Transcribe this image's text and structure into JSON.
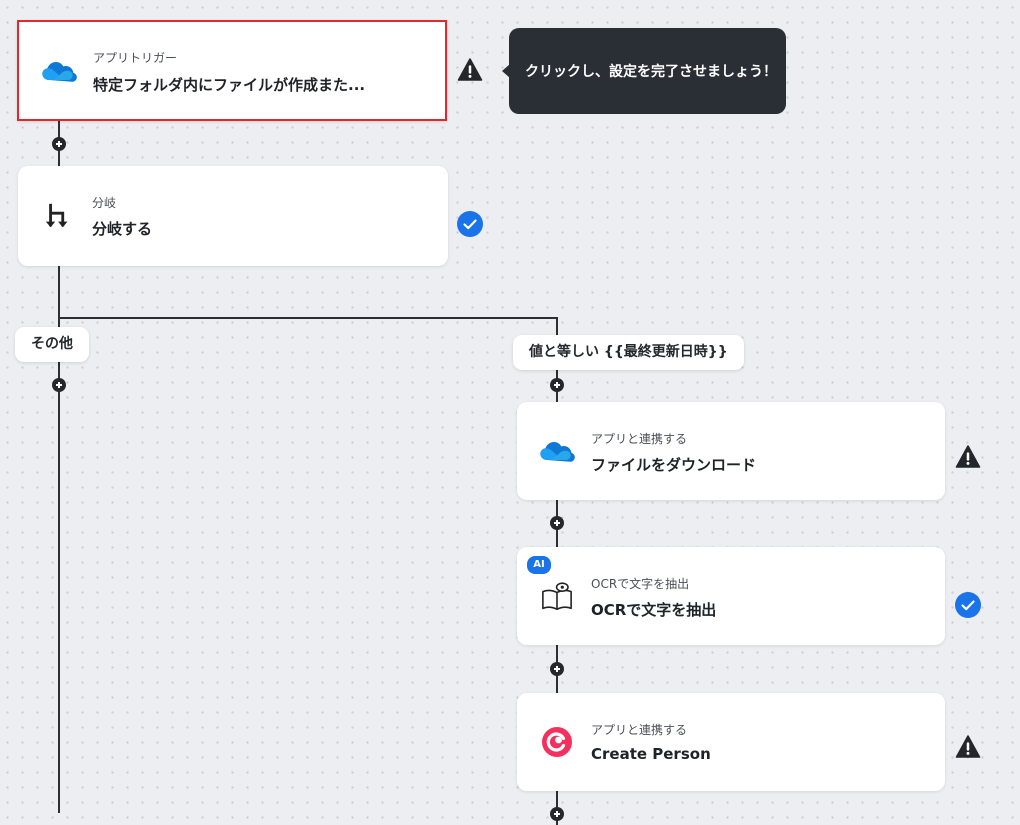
{
  "trigger": {
    "subtitle": "アプリトリガー",
    "title": "特定フォルダ内にファイルが作成また...",
    "icon": "onedrive-cloud-icon",
    "status_icon": "warning-icon"
  },
  "tooltip": {
    "text": "クリックし、設定を完了させましょう！"
  },
  "branch": {
    "subtitle": "分岐",
    "title": "分岐する",
    "icon": "branch-icon",
    "status_icon": "check-circle-icon"
  },
  "branch_labels": {
    "left": "その他",
    "right": "値と等しい {{最終更新日時}}"
  },
  "steps": [
    {
      "badge": "",
      "subtitle": "アプリと連携する",
      "title": "ファイルをダウンロード",
      "icon": "onedrive-cloud-icon",
      "status_icon": "warning-icon"
    },
    {
      "badge": "AI",
      "subtitle": "OCRで文字を抽出",
      "title": "OCRで文字を抽出",
      "icon": "ocr-book-eye-icon",
      "status_icon": "check-circle-icon"
    },
    {
      "badge": "",
      "subtitle": "アプリと連携する",
      "title": "Create Person",
      "icon": "copper-logo-icon",
      "status_icon": "warning-icon"
    }
  ],
  "colors": {
    "selected_border": "#e5262a",
    "check": "#1a73e8",
    "warning": "#23262a",
    "tooltip_bg": "#2a2e35",
    "copper_brand": "#f5305e",
    "onedrive_blue": "#0a64c8"
  }
}
